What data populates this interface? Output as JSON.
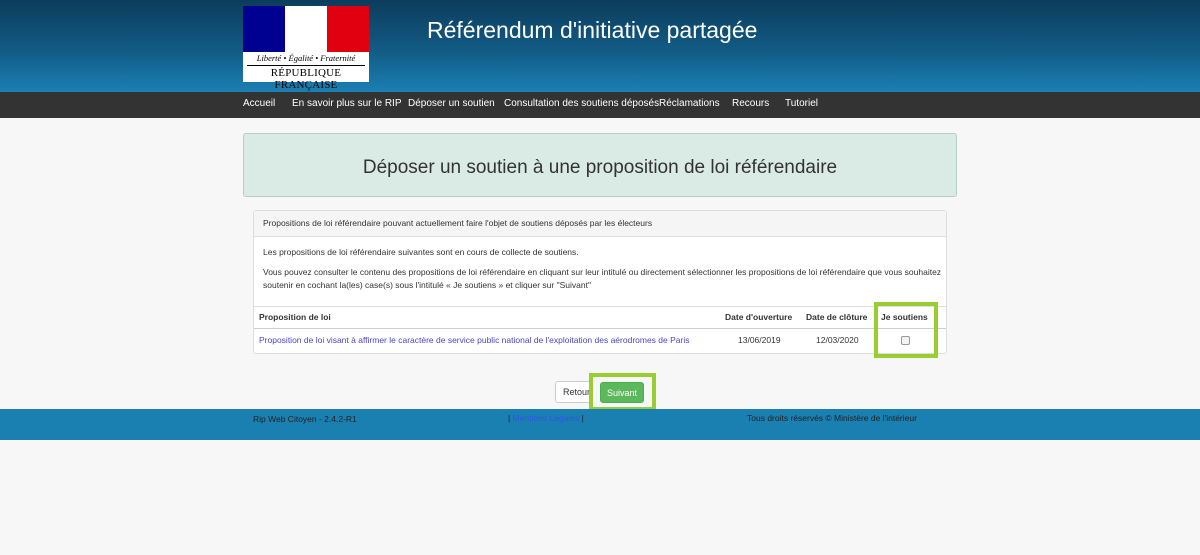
{
  "header": {
    "logo": {
      "motto": "Liberté • Égalité • Fraternité",
      "republique": "RÉPUBLIQUE FRANÇAISE",
      "icon": "marianne-logo-icon",
      "colors": {
        "blue": "#000091",
        "white": "#ffffff",
        "red": "#e1000f"
      }
    },
    "title": "Référendum d'initiative partagée"
  },
  "nav": {
    "items": [
      {
        "label": "Accueil"
      },
      {
        "label": "En savoir plus sur le RIP"
      },
      {
        "label": "Déposer un soutien"
      },
      {
        "label": "Consultation des soutiens déposés"
      },
      {
        "label": "Réclamations"
      },
      {
        "label": "Recours"
      },
      {
        "label": "Tutoriel"
      }
    ]
  },
  "main": {
    "heading": "Déposer un soutien à une proposition de loi référendaire",
    "panel": {
      "title": "Propositions de loi référendaire pouvant actuellement faire l'objet de soutiens déposés par les électeurs",
      "intro": "Les propositions de loi référendaire suivantes sont en cours de collecte de soutiens.",
      "instructions": "Vous pouvez consulter le contenu des propositions de loi référendaire en cliquant sur leur intitulé ou directement sélectionner les propositions de loi référendaire que vous souhaitez soutenir en cochant la(les) case(s) sous l'intitulé « Je soutiens » et cliquer sur \"Suivant\"",
      "table": {
        "headers": [
          "Proposition de loi",
          "Date d'ouverture",
          "Date de clôture",
          "Je soutiens"
        ],
        "rows": [
          {
            "proposition": "Proposition de loi visant à affirmer le caractère de service public national de l'exploitation des aérodromes de Paris",
            "ouverture": "13/06/2019",
            "cloture": "12/03/2020",
            "checked": false
          }
        ]
      }
    },
    "buttons": {
      "retour": "Retour",
      "suivant": "Suivant"
    },
    "highlight_color": "#9acd32"
  },
  "footer": {
    "version": "Rip Web Citoyen - 2.4.2-R1",
    "legal_prefix": "|",
    "legal_link": "Mentions Légales",
    "legal_suffix": "|",
    "rights": "Tous droits réservés © Ministère de l'intérieur"
  }
}
